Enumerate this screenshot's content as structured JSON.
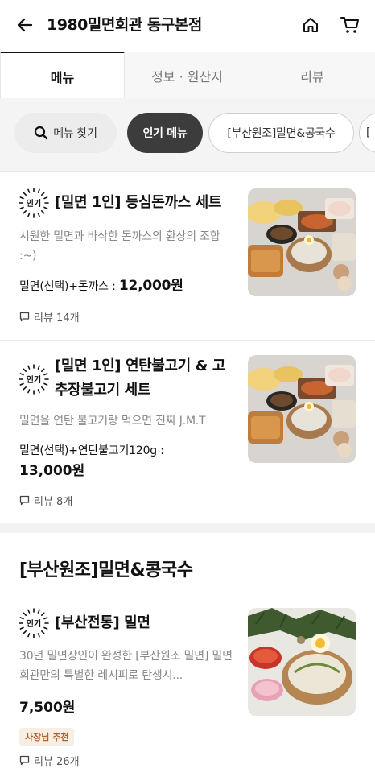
{
  "header": {
    "title": "1980밀면회관 동구본점",
    "back_icon": "arrow-left-icon",
    "home_icon": "home-icon",
    "cart_icon": "cart-icon"
  },
  "tabs": [
    {
      "label": "메뉴",
      "active": true
    },
    {
      "label": "정보 · 원산지",
      "active": false
    },
    {
      "label": "리뷰",
      "active": false
    }
  ],
  "chips": {
    "search_label": "메뉴 찾기",
    "popular_label": "인기 메뉴",
    "category_label": "[부산원조]밀면&콩국수",
    "next_label": "["
  },
  "popular_badge": "인기",
  "items": [
    {
      "title": "[밀면 1인] 등심돈까스 세트",
      "desc": "시원한 밀면과 바삭한 돈까스의 환상의 조합 :~)",
      "price_label": "밀면(선택)+돈까스 : ",
      "price": "12,000원",
      "review": "리뷰 14개"
    },
    {
      "title": "[밀면 1인] 연탄불고기 & 고추장불고기 세트",
      "desc": "밀면을 연탄 불고기랑 먹으면 진짜 J.M.T",
      "price_label": "밀면(선택)+연탄불고기120g :",
      "price": "13,000원",
      "review": "리뷰 8개"
    }
  ],
  "section": {
    "title": "[부산원조]밀면&콩국수",
    "item": {
      "title": "[부산전통] 밀면",
      "desc": "30년 밀면장인이 완성한 [부산원조 밀면] 밀면회관만의 특별한 레시피로 탄생시...",
      "price": "7,500원",
      "tag": "사장님 추천",
      "review": "리뷰 26개"
    }
  },
  "colors": {
    "active_chip": "#3c3c3c",
    "tag_bg": "#f8efe4",
    "tag_text": "#b0602a"
  }
}
